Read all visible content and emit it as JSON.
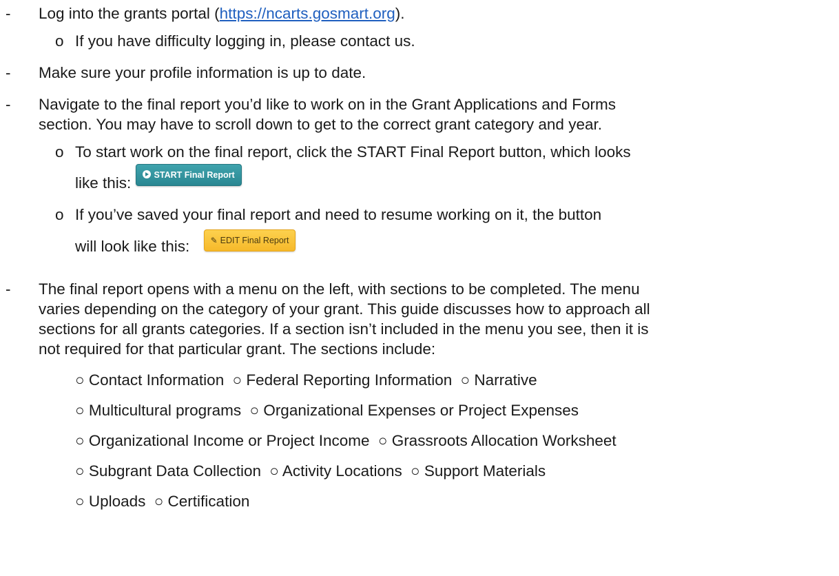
{
  "steps": {
    "login_prefix": "Log into the grants portal (",
    "login_link": "https://ncarts.gosmart.org",
    "login_suffix": ").",
    "login_sub": "If you have difficulty logging in, please contact us.",
    "profile": "Make sure your profile information is up to date.",
    "navigate_1": "Navigate to the final report you’d like to work on in the Grant Applications and Forms",
    "navigate_2": "section. You may have to scroll down to get to the correct grant category and year.",
    "start_1": "To start work on the final report, click the START Final Report button, which looks",
    "start_2": "like this:",
    "start_button": "START Final Report",
    "resume_1": "If you’ve saved your final report and need to resume working on it, the button",
    "resume_2": "will look like this:",
    "edit_button": "EDIT Final Report",
    "menu_1": "The final report opens with a menu on the left, with sections to be completed. The menu",
    "menu_2": "varies depending on the category of your grant. This guide discusses how to approach all",
    "menu_3": "sections for all grants categories. If a section isn’t included in the menu you see, then it is",
    "menu_4": "not required for that particular grant. The sections include:"
  },
  "sections": [
    [
      "Contact Information",
      "Federal Reporting Information",
      "Narrative"
    ],
    [
      "Multicultural programs",
      "Organizational Expenses or Project Expenses"
    ],
    [
      "Organizational Income or Project Income",
      "Grassroots Allocation Worksheet"
    ],
    [
      "Subgrant Data Collection",
      "Activity Locations",
      "Support Materials"
    ],
    [
      "Uploads",
      "Certification"
    ]
  ],
  "bullets": {
    "dash": "-",
    "circle": "o",
    "section_marker": "○"
  },
  "icons": {
    "start": "play-circle-icon",
    "edit": "pencil-square-icon"
  }
}
